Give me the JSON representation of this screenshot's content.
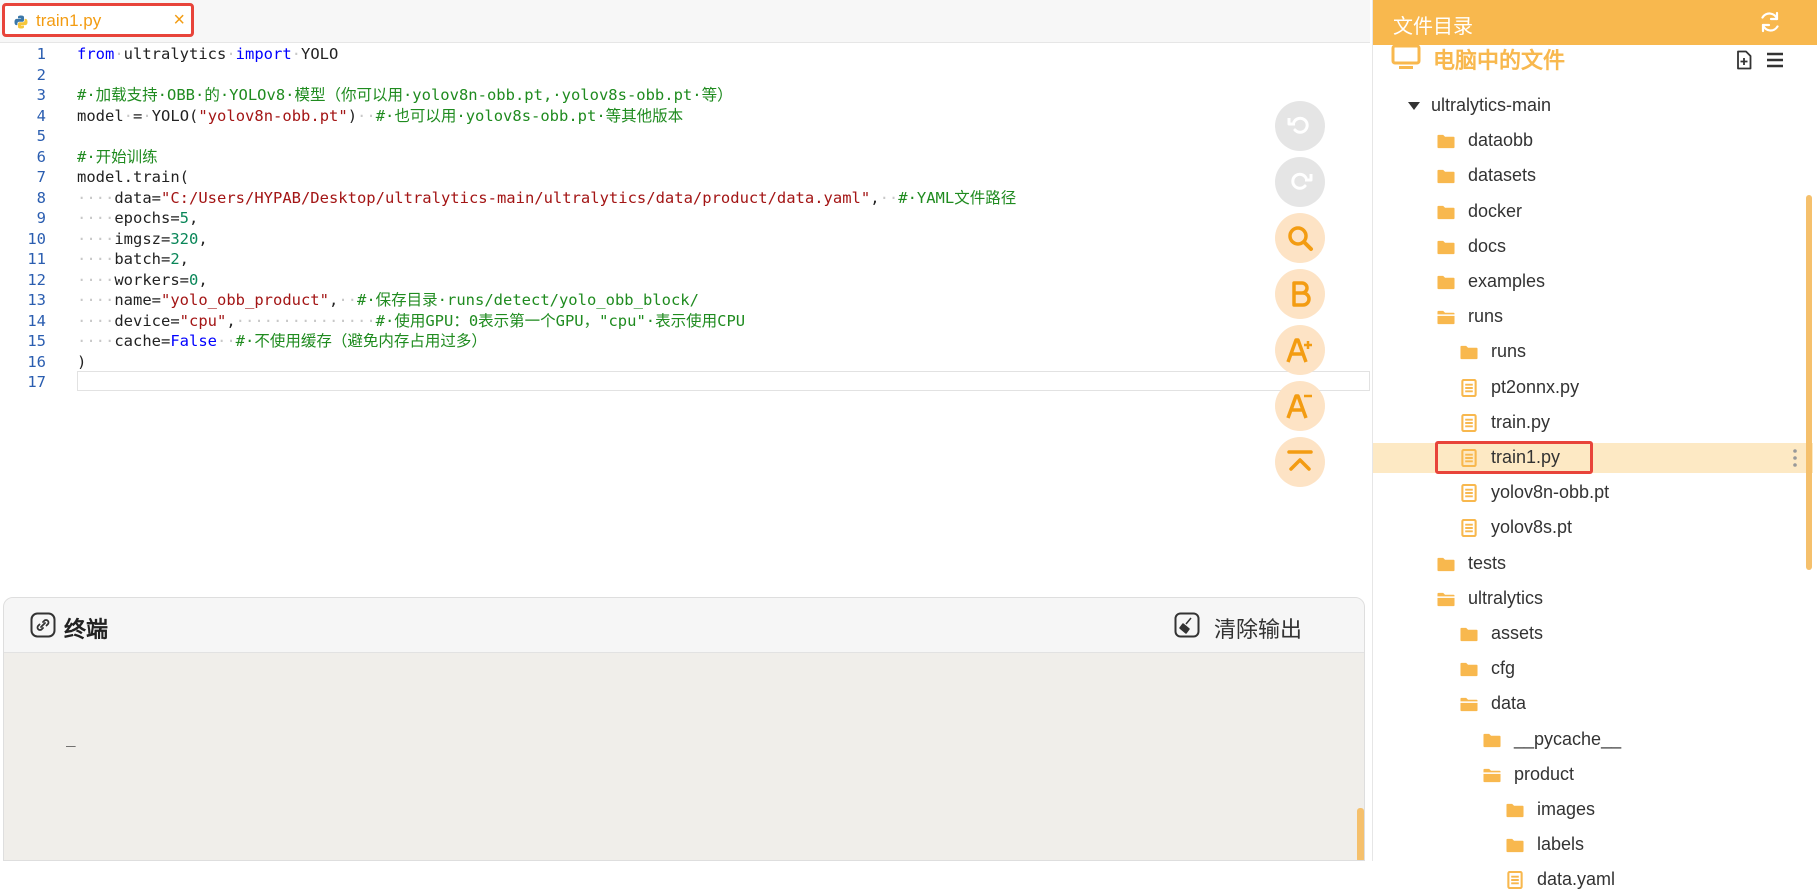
{
  "editor": {
    "tab": {
      "label": "train1.py",
      "close": "×"
    },
    "lines": [
      {
        "n": "1",
        "tokens": [
          [
            "kw",
            "from"
          ],
          [
            "ws",
            "·"
          ],
          [
            "t",
            "ultralytics"
          ],
          [
            "ws",
            "·"
          ],
          [
            "kw",
            "import"
          ],
          [
            "ws",
            "·"
          ],
          [
            "t",
            "YOLO"
          ]
        ]
      },
      {
        "n": "2",
        "tokens": []
      },
      {
        "n": "3",
        "tokens": [
          [
            "com",
            "#·加载支持·OBB·的·YOLOv8·模型（你可以用·yolov8n-obb.pt,·yolov8s-obb.pt·等）"
          ]
        ]
      },
      {
        "n": "4",
        "tokens": [
          [
            "t",
            "model"
          ],
          [
            "ws",
            "·"
          ],
          [
            "t",
            "="
          ],
          [
            "ws",
            "·"
          ],
          [
            "t",
            "YOLO("
          ],
          [
            "str",
            "\"yolov8n-obb.pt\""
          ],
          [
            "t",
            ")"
          ],
          [
            "ws",
            "··"
          ],
          [
            "com",
            "#·也可以用·yolov8s-obb.pt·等其他版本"
          ]
        ]
      },
      {
        "n": "5",
        "tokens": []
      },
      {
        "n": "6",
        "tokens": [
          [
            "com",
            "#·开始训练"
          ]
        ]
      },
      {
        "n": "7",
        "tokens": [
          [
            "t",
            "model.train("
          ]
        ]
      },
      {
        "n": "8",
        "tokens": [
          [
            "ws",
            "····"
          ],
          [
            "t",
            "data="
          ],
          [
            "str",
            "\"C:/Users/HYPAB/Desktop/ultralytics-main/ultralytics/data/product/data.yaml\""
          ],
          [
            "t",
            ","
          ],
          [
            "ws",
            "··"
          ],
          [
            "com",
            "#·YAML文件路径"
          ]
        ]
      },
      {
        "n": "9",
        "tokens": [
          [
            "ws",
            "····"
          ],
          [
            "t",
            "epochs="
          ],
          [
            "num",
            "5"
          ],
          [
            "t",
            ","
          ]
        ]
      },
      {
        "n": "10",
        "tokens": [
          [
            "ws",
            "····"
          ],
          [
            "t",
            "imgsz="
          ],
          [
            "num",
            "320"
          ],
          [
            "t",
            ","
          ]
        ]
      },
      {
        "n": "11",
        "tokens": [
          [
            "ws",
            "····"
          ],
          [
            "t",
            "batch="
          ],
          [
            "num",
            "2"
          ],
          [
            "t",
            ","
          ]
        ]
      },
      {
        "n": "12",
        "tokens": [
          [
            "ws",
            "····"
          ],
          [
            "t",
            "workers="
          ],
          [
            "num",
            "0"
          ],
          [
            "t",
            ","
          ]
        ]
      },
      {
        "n": "13",
        "tokens": [
          [
            "ws",
            "····"
          ],
          [
            "t",
            "name="
          ],
          [
            "str",
            "\"yolo_obb_product\""
          ],
          [
            "t",
            ","
          ],
          [
            "ws",
            "··"
          ],
          [
            "com",
            "#·保存目录·runs/detect/yolo_obb_block/"
          ]
        ]
      },
      {
        "n": "14",
        "tokens": [
          [
            "ws",
            "····"
          ],
          [
            "t",
            "device="
          ],
          [
            "str",
            "\"cpu\""
          ],
          [
            "t",
            ","
          ],
          [
            "ws",
            "···············"
          ],
          [
            "com",
            "#·使用GPU：0表示第一个GPU，\"cpu\"·表示使用CPU"
          ]
        ]
      },
      {
        "n": "15",
        "tokens": [
          [
            "ws",
            "····"
          ],
          [
            "t",
            "cache="
          ],
          [
            "kw",
            "False"
          ],
          [
            "ws",
            "··"
          ],
          [
            "com",
            "#·不使用缓存（避免内存占用过多）"
          ]
        ]
      },
      {
        "n": "16",
        "tokens": [
          [
            "t",
            ")"
          ]
        ]
      },
      {
        "n": "17",
        "tokens": []
      }
    ],
    "tools": [
      {
        "name": "undo-button",
        "icon": "undo-icon",
        "style": "gray"
      },
      {
        "name": "redo-button",
        "icon": "redo-icon",
        "style": "gray"
      },
      {
        "name": "search-button",
        "icon": "search-icon",
        "style": "orange"
      },
      {
        "name": "bold-button",
        "icon": "bold-icon",
        "style": "orange"
      },
      {
        "name": "font-increase-button",
        "icon": "font-increase-icon",
        "style": "orange"
      },
      {
        "name": "font-decrease-button",
        "icon": "font-decrease-icon",
        "style": "orange"
      },
      {
        "name": "scroll-top-button",
        "icon": "scroll-top-icon",
        "style": "orange"
      }
    ]
  },
  "terminal": {
    "title": "终端",
    "clear_label": "清除输出",
    "cursor": "_"
  },
  "explorer": {
    "title": "文件目录",
    "section": "电脑中的文件",
    "items": [
      {
        "label": "ultralytics-main",
        "type": "root",
        "depth": 0
      },
      {
        "label": "dataobb",
        "type": "folder",
        "depth": 1
      },
      {
        "label": "datasets",
        "type": "folder",
        "depth": 1
      },
      {
        "label": "docker",
        "type": "folder",
        "depth": 1
      },
      {
        "label": "docs",
        "type": "folder",
        "depth": 1
      },
      {
        "label": "examples",
        "type": "folder",
        "depth": 1
      },
      {
        "label": "runs",
        "type": "folder-open",
        "depth": 1
      },
      {
        "label": "runs",
        "type": "folder",
        "depth": 2
      },
      {
        "label": "pt2onnx.py",
        "type": "file",
        "depth": 2
      },
      {
        "label": "train.py",
        "type": "file",
        "depth": 2
      },
      {
        "label": "train1.py",
        "type": "file",
        "depth": 2,
        "selected": true
      },
      {
        "label": "yolov8n-obb.pt",
        "type": "file",
        "depth": 2
      },
      {
        "label": "yolov8s.pt",
        "type": "file",
        "depth": 2
      },
      {
        "label": "tests",
        "type": "folder",
        "depth": 1
      },
      {
        "label": "ultralytics",
        "type": "folder-open",
        "depth": 1
      },
      {
        "label": "assets",
        "type": "folder",
        "depth": 2
      },
      {
        "label": "cfg",
        "type": "folder",
        "depth": 2
      },
      {
        "label": "data",
        "type": "folder-open",
        "depth": 2
      },
      {
        "label": "__pycache__",
        "type": "folder",
        "depth": 3
      },
      {
        "label": "product",
        "type": "folder-open",
        "depth": 3
      },
      {
        "label": "images",
        "type": "folder",
        "depth": 4
      },
      {
        "label": "labels",
        "type": "folder",
        "depth": 4
      },
      {
        "label": "data.yaml",
        "type": "file",
        "depth": 4
      }
    ]
  },
  "colors": {
    "accent": "#f8b84e",
    "highlight_border": "#e8443a",
    "selected_row": "#fde9c4"
  }
}
